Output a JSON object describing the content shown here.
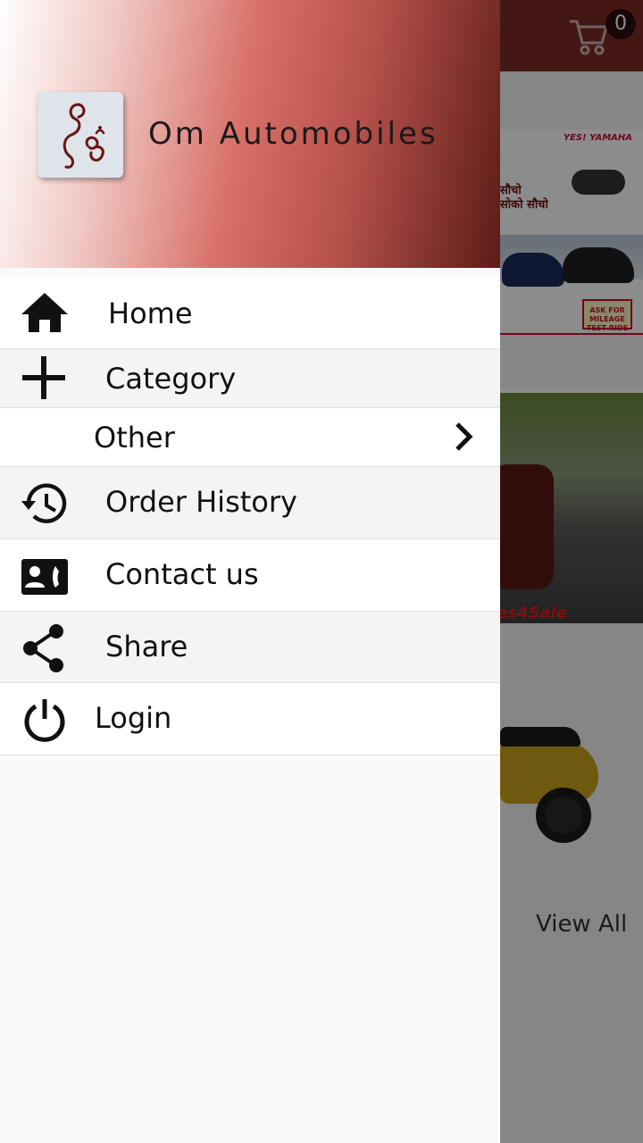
{
  "cart": {
    "count": "0"
  },
  "banner": {
    "brand": "YES! YAMAHA",
    "tagline_1": "सौचो",
    "tagline_2": "सोको सौचो",
    "test_ride": "ASK FOR MILEAGE TEST RIDE",
    "sale": "es4Sale"
  },
  "content": {
    "view_all": "View All"
  },
  "drawer": {
    "app_name": "Om Automobiles",
    "items": [
      {
        "label": "Home",
        "icon": "home-icon"
      },
      {
        "label": "Category",
        "icon": "plus-icon"
      },
      {
        "label": "Other",
        "icon": "chevron-right-icon"
      },
      {
        "label": "Order History",
        "icon": "history-icon"
      },
      {
        "label": "Contact us",
        "icon": "contact-card-icon"
      },
      {
        "label": "Share",
        "icon": "share-icon"
      },
      {
        "label": "Login",
        "icon": "power-icon"
      }
    ]
  },
  "colors": {
    "toolbar": "#7b2a24",
    "drawer_bg": "#fafafa",
    "header_gradient_end": "#5c1c18"
  }
}
